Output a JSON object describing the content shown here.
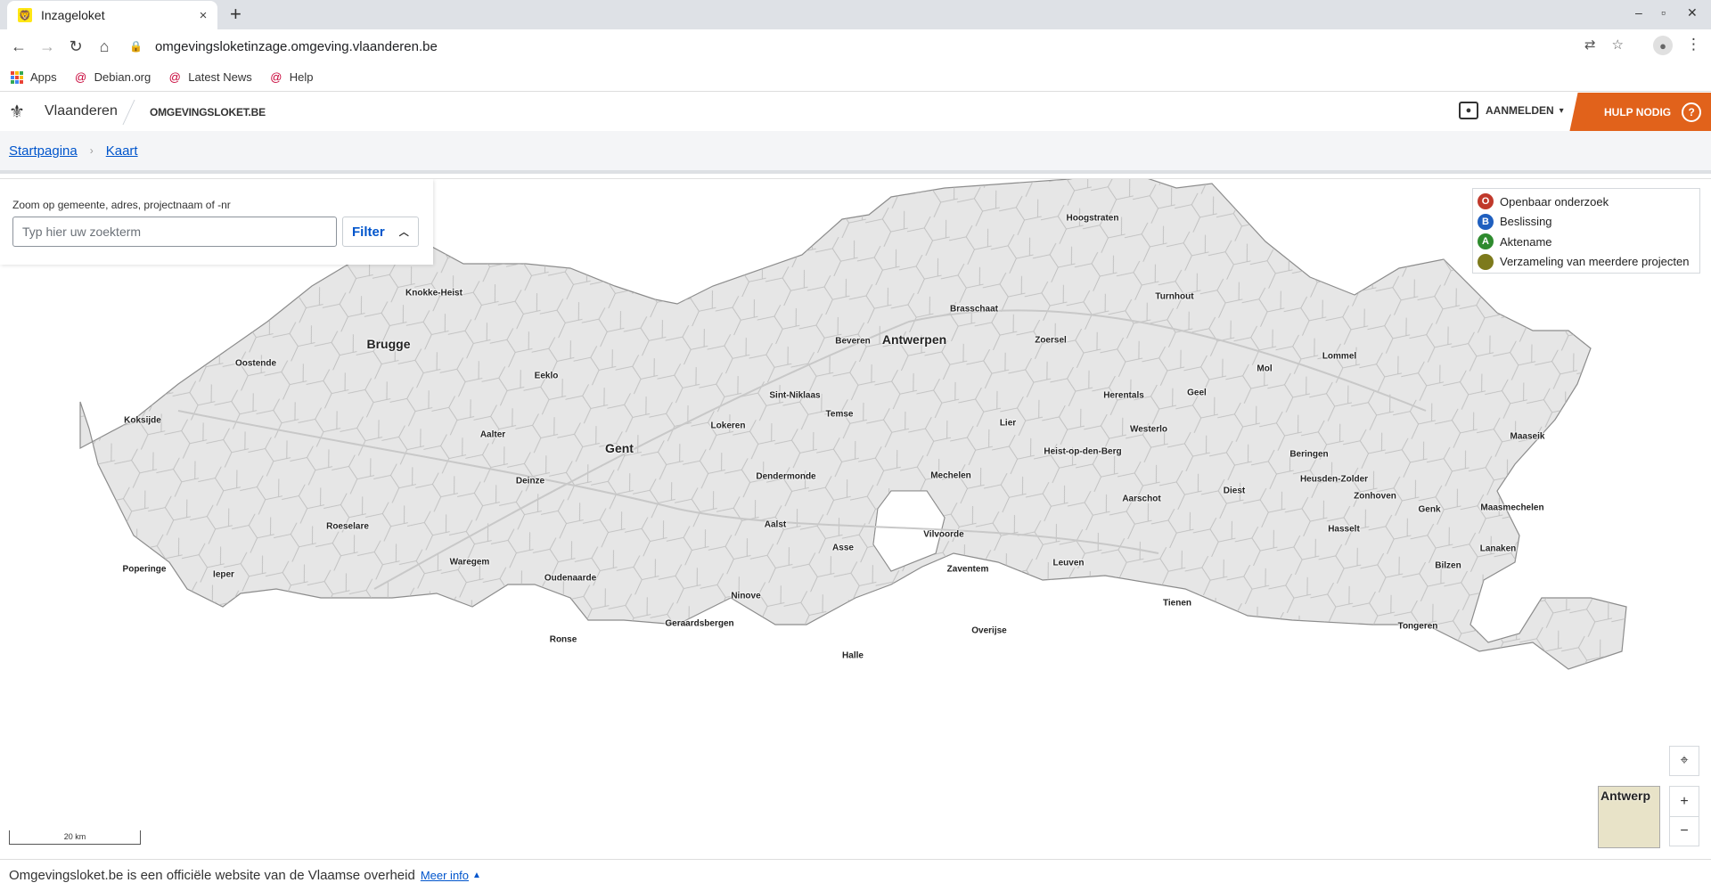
{
  "browser": {
    "tab_title": "Inzageloket",
    "tab_close": "×",
    "new_tab": "+",
    "url": "omgevingsloketinzage.omgeving.vlaanderen.be",
    "window_controls": [
      "–",
      "▫",
      "✕"
    ],
    "bookmarks": [
      {
        "label": "Apps",
        "icon": "apps-grid-icon"
      },
      {
        "label": "Debian.org",
        "icon": "debian-icon"
      },
      {
        "label": "Latest News",
        "icon": "debian-icon"
      },
      {
        "label": "Help",
        "icon": "debian-icon"
      }
    ]
  },
  "site_header": {
    "brand": "Vlaanderen",
    "site": "OMGEVINGSLOKET.BE",
    "login_label": "AANMELDEN",
    "help_label": "HULP NODIG",
    "help_icon": "?"
  },
  "breadcrumb": {
    "items": [
      "Startpagina",
      "Kaart"
    ],
    "separator": "›"
  },
  "search": {
    "caption": "Zoom op gemeente, adres, projectnaam of -nr",
    "placeholder": "Typ hier uw zoekterm",
    "value": "",
    "filter_label": "Filter"
  },
  "legend": [
    {
      "letter": "O",
      "label": "Openbaar onderzoek",
      "color": "#c0392b"
    },
    {
      "letter": "B",
      "label": "Beslissing",
      "color": "#1f5fbf"
    },
    {
      "letter": "A",
      "label": "Aktename",
      "color": "#2e8b2e"
    },
    {
      "letter": "",
      "label": "Verzameling van meerdere projecten",
      "color": "#7d7a1c"
    }
  ],
  "map": {
    "cities": [
      {
        "name": "Hoogstraten",
        "big": false
      },
      {
        "name": "Knokke-Heist",
        "big": false
      },
      {
        "name": "Turnhout",
        "big": false
      },
      {
        "name": "Brasschaat",
        "big": false
      },
      {
        "name": "Brugge",
        "big": true
      },
      {
        "name": "Beveren",
        "big": false
      },
      {
        "name": "Antwerpen",
        "big": true
      },
      {
        "name": "Zoersel",
        "big": false
      },
      {
        "name": "Lommel",
        "big": false
      },
      {
        "name": "Oostende",
        "big": false
      },
      {
        "name": "Mol",
        "big": false
      },
      {
        "name": "Eeklo",
        "big": false
      },
      {
        "name": "Sint-Niklaas",
        "big": false
      },
      {
        "name": "Herentals",
        "big": false
      },
      {
        "name": "Geel",
        "big": false
      },
      {
        "name": "Temse",
        "big": false
      },
      {
        "name": "Koksijde",
        "big": false
      },
      {
        "name": "Lier",
        "big": false
      },
      {
        "name": "Lokeren",
        "big": false
      },
      {
        "name": "Westerlo",
        "big": false
      },
      {
        "name": "Aalter",
        "big": false
      },
      {
        "name": "Maaseik",
        "big": false
      },
      {
        "name": "Gent",
        "big": true
      },
      {
        "name": "Heist-op-den-Berg",
        "big": false
      },
      {
        "name": "Beringen",
        "big": false
      },
      {
        "name": "Mechelen",
        "big": false
      },
      {
        "name": "Dendermonde",
        "big": false
      },
      {
        "name": "Heusden-Zolder",
        "big": false
      },
      {
        "name": "Deinze",
        "big": false
      },
      {
        "name": "Diest",
        "big": false
      },
      {
        "name": "Zonhoven",
        "big": false
      },
      {
        "name": "Aarschot",
        "big": false
      },
      {
        "name": "Genk",
        "big": false
      },
      {
        "name": "Maasmechelen",
        "big": false
      },
      {
        "name": "Aalst",
        "big": false
      },
      {
        "name": "Roeselare",
        "big": false
      },
      {
        "name": "Hasselt",
        "big": false
      },
      {
        "name": "Vilvoorde",
        "big": false
      },
      {
        "name": "Asse",
        "big": false
      },
      {
        "name": "Lanaken",
        "big": false
      },
      {
        "name": "Waregem",
        "big": false
      },
      {
        "name": "Leuven",
        "big": false
      },
      {
        "name": "Bilzen",
        "big": false
      },
      {
        "name": "Zaventem",
        "big": false
      },
      {
        "name": "Poperinge",
        "big": false
      },
      {
        "name": "Ieper",
        "big": false
      },
      {
        "name": "Oudenaarde",
        "big": false
      },
      {
        "name": "Ninove",
        "big": false
      },
      {
        "name": "Tienen",
        "big": false
      },
      {
        "name": "Geraardsbergen",
        "big": false
      },
      {
        "name": "Tongeren",
        "big": false
      },
      {
        "name": "Overijse",
        "big": false
      },
      {
        "name": "Ronse",
        "big": false
      },
      {
        "name": "Halle",
        "big": false
      }
    ],
    "overview_label": "Antwerp",
    "scale_label": "20 km",
    "zoom_in": "+",
    "zoom_out": "−"
  },
  "footer": {
    "text": "Omgevingsloket.be is een officiële website van de Vlaamse overheid",
    "link": "Meer info"
  }
}
